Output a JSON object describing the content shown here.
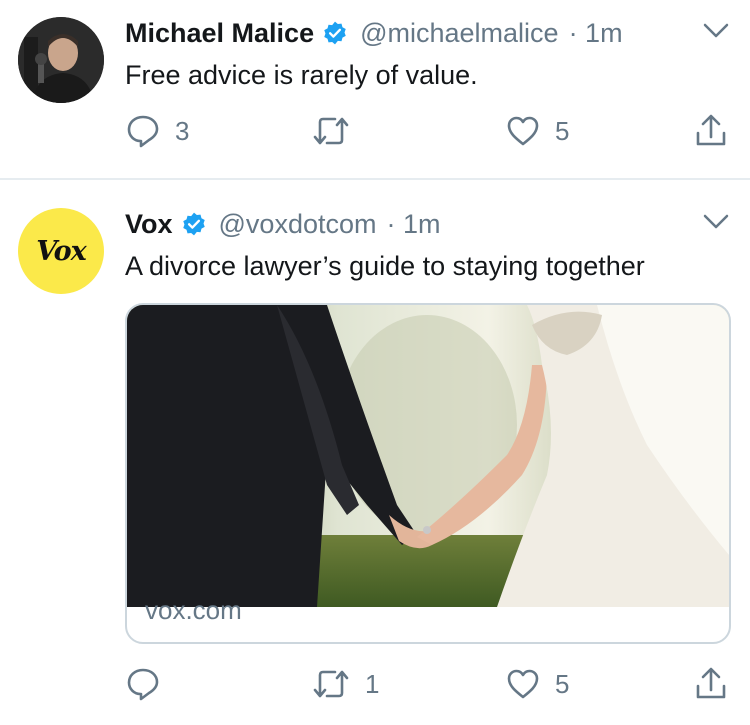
{
  "tweets": [
    {
      "name": "Michael Malice",
      "handle": "@michaelmalice",
      "time": "· 1m",
      "text": "Free advice is rarely of value.",
      "actions": {
        "reply": "3",
        "retweet": "",
        "like": "5"
      }
    },
    {
      "name": "Vox",
      "handle": "@voxdotcom",
      "time": "· 1m",
      "text": "A divorce lawyer’s guide to staying together",
      "avatar_text": "Vox",
      "card": {
        "domain": "vox.com"
      },
      "actions": {
        "reply": "",
        "retweet": "1",
        "like": "5"
      }
    }
  ],
  "colors": {
    "verified": "#1da1f2",
    "secondary": "#657786",
    "divider": "#e6ecf0",
    "vox_yellow": "#fbe94a"
  }
}
